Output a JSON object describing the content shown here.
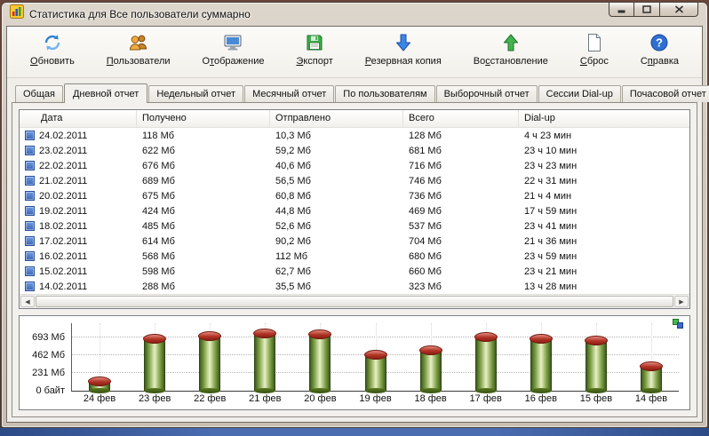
{
  "window": {
    "title": "Статистика для Все пользователи суммарно"
  },
  "toolbar": {
    "items": [
      {
        "pre": "",
        "key": "О",
        "post": "бновить"
      },
      {
        "pre": "",
        "key": "П",
        "post": "ользователи"
      },
      {
        "pre": "О",
        "key": "т",
        "post": "ображение"
      },
      {
        "pre": "",
        "key": "Э",
        "post": "кспорт"
      },
      {
        "pre": "",
        "key": "Р",
        "post": "езервная копия"
      },
      {
        "pre": "Во",
        "key": "с",
        "post": "становление"
      },
      {
        "pre": "",
        "key": "С",
        "post": "брос"
      },
      {
        "pre": "С",
        "key": "п",
        "post": "равка"
      }
    ]
  },
  "tabs": {
    "items": [
      "Общая",
      "Дневной отчет",
      "Недельный отчет",
      "Месячный отчет",
      "По пользователям",
      "Выборочный отчет",
      "Сессии Dial-up",
      "Почасовой отчет"
    ],
    "active": "Дневной отчет"
  },
  "table": {
    "columns": [
      "Дата",
      "Получено",
      "Отправлено",
      "Всего",
      "Dial-up"
    ],
    "rows": [
      {
        "date": "24.02.2011",
        "received": "118 Мб",
        "sent": "10,3 Мб",
        "total": "128 Мб",
        "dialup": "4 ч 23 мин"
      },
      {
        "date": "23.02.2011",
        "received": "622 Мб",
        "sent": "59,2 Мб",
        "total": "681 Мб",
        "dialup": "23 ч 10 мин"
      },
      {
        "date": "22.02.2011",
        "received": "676 Мб",
        "sent": "40,6 Мб",
        "total": "716 Мб",
        "dialup": "23 ч 23 мин"
      },
      {
        "date": "21.02.2011",
        "received": "689 Мб",
        "sent": "56,5 Мб",
        "total": "746 Мб",
        "dialup": "22 ч 31 мин"
      },
      {
        "date": "20.02.2011",
        "received": "675 Мб",
        "sent": "60,8 Мб",
        "total": "736 Мб",
        "dialup": "21 ч 4 мин"
      },
      {
        "date": "19.02.2011",
        "received": "424 Мб",
        "sent": "44,8 Мб",
        "total": "469 Мб",
        "dialup": "17 ч 59 мин"
      },
      {
        "date": "18.02.2011",
        "received": "485 Мб",
        "sent": "52,6 Мб",
        "total": "537 Мб",
        "dialup": "23 ч 41 мин"
      },
      {
        "date": "17.02.2011",
        "received": "614 Мб",
        "sent": "90,2 Мб",
        "total": "704 Мб",
        "dialup": "21 ч 36 мин"
      },
      {
        "date": "16.02.2011",
        "received": "568 Мб",
        "sent": "112 Мб",
        "total": "680 Мб",
        "dialup": "23 ч 59 мин"
      },
      {
        "date": "15.02.2011",
        "received": "598 Мб",
        "sent": "62,7 Мб",
        "total": "660 Мб",
        "dialup": "23 ч 21 мин"
      },
      {
        "date": "14.02.2011",
        "received": "288 Мб",
        "sent": "35,5 Мб",
        "total": "323 Мб",
        "dialup": "13 ч 28 мин"
      }
    ]
  },
  "chart_data": {
    "type": "bar",
    "categories": [
      "24 фев",
      "23 фев",
      "22 фев",
      "21 фев",
      "20 фев",
      "19 фев",
      "18 фев",
      "17 фев",
      "16 фев",
      "15 фев",
      "14 фев"
    ],
    "values": [
      128,
      681,
      716,
      746,
      736,
      469,
      537,
      704,
      680,
      660,
      323
    ],
    "title": "",
    "xlabel": "",
    "ylabel": "",
    "unit": "Мб",
    "ytick_values": [
      693,
      462,
      231,
      0
    ],
    "ytick_labels": [
      "693 Мб",
      "462 Мб",
      "231 Мб",
      "0 байт"
    ],
    "ylim": [
      0,
      760
    ],
    "grid": true,
    "bar_color": "#7fa046",
    "cap_color": "#b03324"
  }
}
